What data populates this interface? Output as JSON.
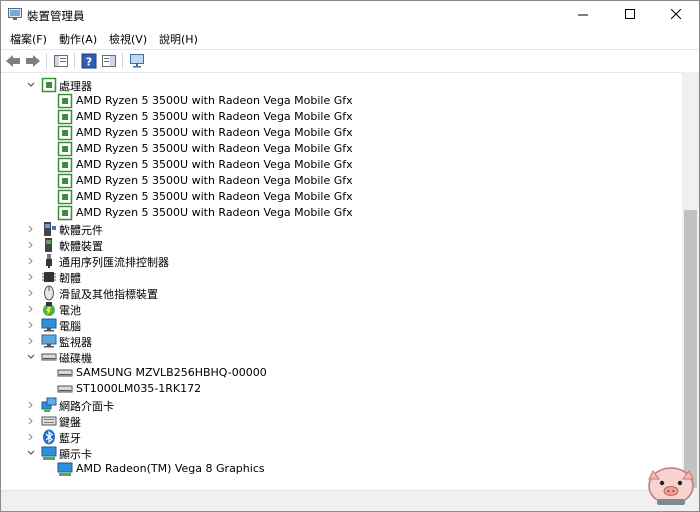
{
  "window": {
    "title": "裝置管理員"
  },
  "menu": {
    "items": [
      "檔案(F)",
      "動作(A)",
      "檢視(V)",
      "說明(H)"
    ]
  },
  "tree": {
    "processors": {
      "label": "處理器",
      "children": [
        "AMD Ryzen 5 3500U with Radeon Vega Mobile Gfx",
        "AMD Ryzen 5 3500U with Radeon Vega Mobile Gfx",
        "AMD Ryzen 5 3500U with Radeon Vega Mobile Gfx",
        "AMD Ryzen 5 3500U with Radeon Vega Mobile Gfx",
        "AMD Ryzen 5 3500U with Radeon Vega Mobile Gfx",
        "AMD Ryzen 5 3500U with Radeon Vega Mobile Gfx",
        "AMD Ryzen 5 3500U with Radeon Vega Mobile Gfx",
        "AMD Ryzen 5 3500U with Radeon Vega Mobile Gfx"
      ]
    },
    "software_components": "軟體元件",
    "software_devices": "軟體裝置",
    "usb_controllers": "通用序列匯流排控制器",
    "firmware": "韌體",
    "mice": "滑鼠及其他指標裝置",
    "batteries": "電池",
    "computer": "電腦",
    "monitors": "監視器",
    "disk_drives": {
      "label": "磁碟機",
      "children": [
        "SAMSUNG MZVLB256HBHQ-00000",
        "ST1000LM035-1RK172"
      ]
    },
    "network_adapters": "網路介面卡",
    "keyboards": "鍵盤",
    "bluetooth": "藍牙",
    "display_adapters": {
      "label": "顯示卡",
      "children": [
        "AMD Radeon(TM) Vega 8 Graphics"
      ]
    }
  },
  "colors": {
    "accent": "#0063b1",
    "processor_icon": "#3c8c3c",
    "scrollbar_thumb": "#c2c2c2"
  }
}
